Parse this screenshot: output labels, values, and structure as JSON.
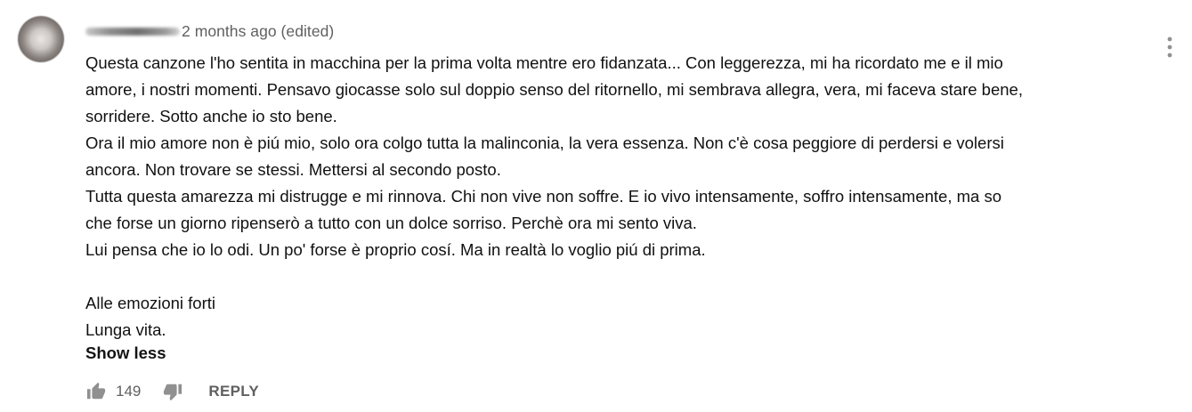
{
  "comment": {
    "timestamp": "2 months ago (edited)",
    "lines": [
      "Questa canzone l'ho sentita in macchina per la prima volta mentre ero fidanzata... Con leggerezza, mi ha ricordato me e il mio",
      "amore, i nostri momenti. Pensavo giocasse solo sul doppio senso del ritornello, mi sembrava allegra, vera, mi faceva stare bene,",
      "sorridere. Sotto anche io sto bene.",
      "Ora il mio amore non è piú mio, solo ora colgo tutta la malinconia, la vera essenza. Non c'è cosa peggiore di perdersi e volersi",
      "ancora. Non trovare se stessi. Mettersi al secondo posto.",
      "Tutta questa amarezza mi distrugge e mi rinnova. Chi non vive non soffre. E io vivo intensamente, soffro intensamente, ma so",
      "che forse un giorno ripenserò a tutto con un dolce sorriso. Perchè ora mi sento viva.",
      "Lui pensa che io lo odi. Un po' forse è proprio cosí. Ma in realtà lo voglio piú di prima.",
      "",
      "Alle emozioni forti",
      "Lunga vita."
    ],
    "show_less_label": "Show less",
    "like_count": "149",
    "reply_label": "REPLY"
  },
  "icons": {
    "like": "thumb-up-icon",
    "dislike": "thumb-down-icon",
    "menu": "more-vertical-icon"
  },
  "colors": {
    "text": "#111111",
    "secondary": "#606060",
    "icon": "#909090"
  }
}
